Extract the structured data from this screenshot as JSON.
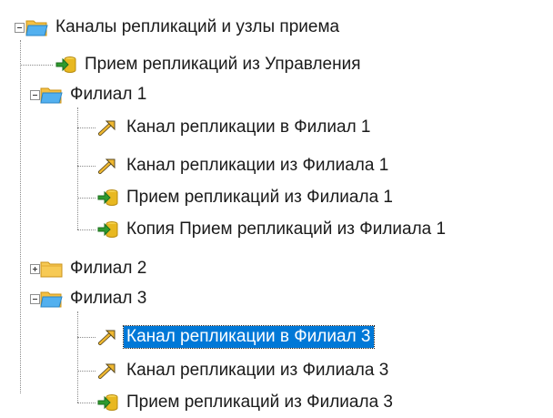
{
  "tree": {
    "root": {
      "label": "Каналы репликаций и узлы приема",
      "icon": "folder-open-icon",
      "expanded": true
    },
    "items": [
      {
        "label": "Прием репликаций из Управления",
        "icon": "receive-node-icon",
        "level": 1
      },
      {
        "label": "Филиал 1",
        "icon": "folder-open-icon",
        "level": 1,
        "expanded": true
      },
      {
        "label": "Канал репликации в Филиал 1",
        "icon": "channel-arrow-icon",
        "level": 2
      },
      {
        "label": "Канал репликации из Филиала 1",
        "icon": "channel-arrow-icon",
        "level": 2
      },
      {
        "label": "Прием репликаций из Филиала 1",
        "icon": "receive-node-icon",
        "level": 2
      },
      {
        "label": "Копия Прием репликаций из Филиала 1",
        "icon": "receive-node-icon",
        "level": 2
      },
      {
        "label": "Филиал 2",
        "icon": "folder-closed-icon",
        "level": 1,
        "expanded": false
      },
      {
        "label": "Филиал 3",
        "icon": "folder-open-icon",
        "level": 1,
        "expanded": true
      },
      {
        "label": "Канал репликации в Филиал 3",
        "icon": "channel-arrow-icon",
        "level": 2,
        "selected": true
      },
      {
        "label": "Канал репликации из Филиала 3",
        "icon": "channel-arrow-icon",
        "level": 2
      },
      {
        "label": "Прием репликаций из Филиала 3",
        "icon": "receive-node-icon",
        "level": 2
      }
    ],
    "colors": {
      "folder": "#f5c042",
      "folder_dark": "#d89c1e",
      "folder_open": "#3aa0e8",
      "selection": "#0078d7",
      "arrow": "#e0a020",
      "receive_cylinder": "#e8b820",
      "receive_arrow": "#2e9a2e"
    }
  }
}
